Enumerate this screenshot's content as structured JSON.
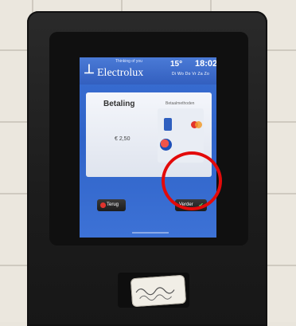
{
  "screen": {
    "brand": "Electrolux",
    "brand_tagline": "Thinking of you",
    "temperature": "15°",
    "time": "18:02",
    "date_row": "Di Wo Do Vr Za Zo",
    "payment": {
      "title": "Betaling",
      "method_label": "Betaalmethoden",
      "amount": "€ 2,50"
    },
    "buttons": {
      "back_label": "Terug",
      "next_label": "Verder"
    }
  },
  "colors": {
    "screen_blue": "#2f63c8",
    "highlight_red": "#e30a0a",
    "confirm_green": "#5bd35b"
  },
  "icons": [
    "electrolux-logo-icon",
    "card-icon",
    "maestro-icon",
    "check-icon"
  ]
}
